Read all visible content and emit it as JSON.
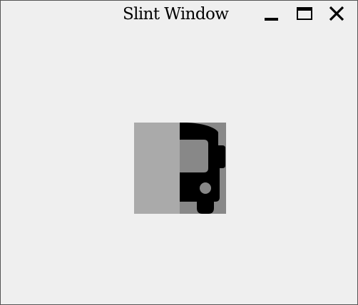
{
  "window": {
    "title": "Slint Window",
    "controls": {
      "minimize_icon": "minimize-icon",
      "maximize_icon": "maximize-icon",
      "close_icon": "close-icon"
    }
  },
  "colors": {
    "window_background": "#efefef",
    "window_border": "#555555",
    "panel_left": "#aaaaaa",
    "panel_right": "#888888",
    "icon_fill": "#000000"
  },
  "content": {
    "icon": "bus-icon"
  }
}
